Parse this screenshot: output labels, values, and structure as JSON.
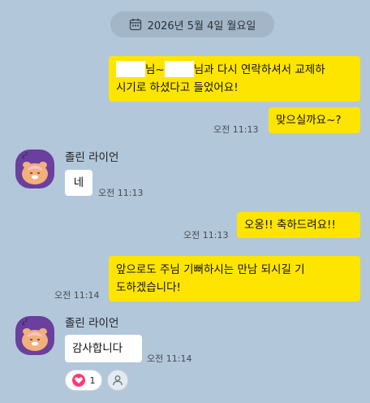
{
  "date_divider": {
    "text": "2026년 5월 4일 월요일",
    "icon": "calendar-icon"
  },
  "messages": [
    {
      "sender": "me",
      "line1_mid": "님~",
      "line1_end": "님과 다시 연락하셔서 교제하",
      "line2": "시기로 하셨다고 들었어요!",
      "time": ""
    },
    {
      "sender": "me",
      "text": "맞으실까요~?",
      "time": "오전 11:13"
    },
    {
      "sender": "them",
      "name": "졸린 라이언",
      "text": "네",
      "time": "오전 11:13"
    },
    {
      "sender": "me",
      "text": "오옹!! 축하드려요!!",
      "time": "오전 11:13"
    },
    {
      "sender": "me",
      "line1": "앞으로도 주님 기뻐하시는 만남 되시길 기",
      "line2": "도하겠습니다!",
      "time": "오전 11:14"
    },
    {
      "sender": "them",
      "name": "졸린 라이언",
      "text": "감사합니다",
      "time": "오전 11:14"
    }
  ],
  "reaction": {
    "heart_count": "1",
    "heart_icon": "heart-icon",
    "person_icon": "person-icon"
  },
  "colors": {
    "background": "#b2c7da",
    "my_bubble": "#fee500",
    "their_bubble": "#ffffff",
    "avatar": "#6a3f9e",
    "heart": "#ff3b77"
  }
}
